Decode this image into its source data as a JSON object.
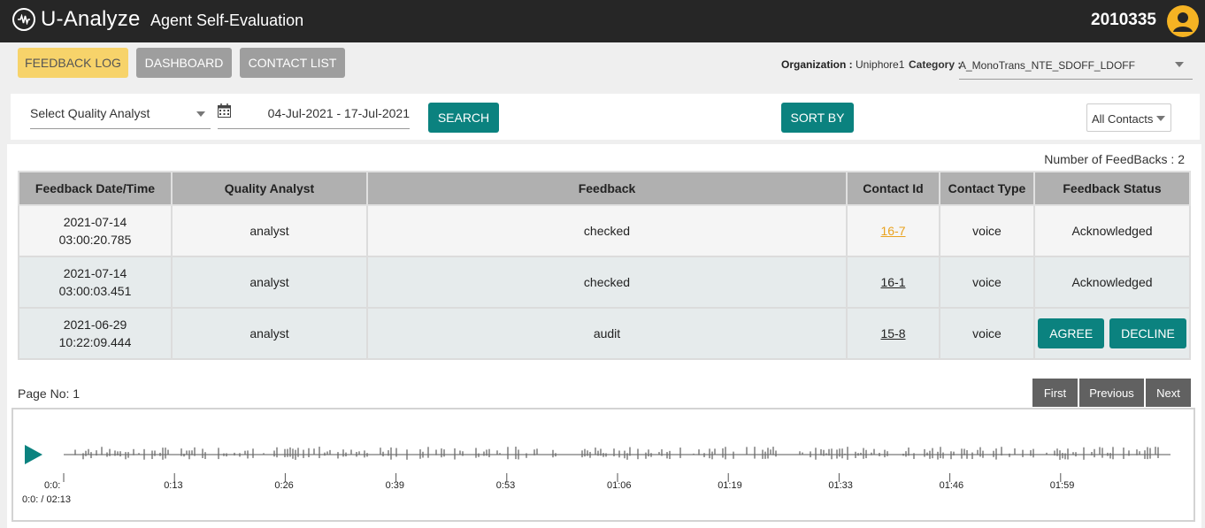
{
  "header": {
    "logo_text": "U-Analyze",
    "app_title": "Agent Self-Evaluation",
    "user_id": "2010335"
  },
  "nav": {
    "tabs": [
      {
        "label": "FEEDBACK LOG",
        "active": true
      },
      {
        "label": "DASHBOARD",
        "active": false
      },
      {
        "label": "CONTACT LIST",
        "active": false
      }
    ]
  },
  "filters": {
    "organization_label": "Organization :",
    "organization_value": "Uniphore1",
    "category_label": "Category :",
    "category_value": "A_MonoTrans_NTE_SDOFF_LDOFF",
    "quality_analyst_placeholder": "Select Quality Analyst",
    "date_range": "04-Jul-2021 - 17-Jul-2021",
    "search_label": "SEARCH",
    "sort_label": "SORT BY",
    "contacts_filter": "All Contacts"
  },
  "feedback": {
    "count_text": "Number of FeedBacks : 2",
    "columns": [
      "Feedback Date/Time",
      "Quality Analyst",
      "Feedback",
      "Contact Id",
      "Contact Type",
      "Feedback Status"
    ],
    "rows": [
      {
        "date": "2021-07-14",
        "time": "03:00:20.785",
        "analyst": "analyst",
        "feedback": "checked",
        "contact_id": "16-7",
        "contact_type": "voice",
        "status": "Acknowledged"
      },
      {
        "date": "2021-07-14",
        "time": "03:00:03.451",
        "analyst": "analyst",
        "feedback": "checked",
        "contact_id": "16-1",
        "contact_type": "voice",
        "status": "Acknowledged"
      },
      {
        "date": "2021-06-29",
        "time": "10:22:09.444",
        "analyst": "analyst",
        "feedback": "audit",
        "contact_id": "15-8",
        "contact_type": "voice",
        "agree_label": "AGREE",
        "decline_label": "DECLINE"
      }
    ]
  },
  "pagination": {
    "page_text": "Page No: 1",
    "first": "First",
    "previous": "Previous",
    "next": "Next"
  },
  "player": {
    "ticks": [
      "0:0:",
      "0:13",
      "0:26",
      "0:39",
      "0:53",
      "01:06",
      "01:19",
      "01:33",
      "01:46",
      "01:59"
    ],
    "time_display": "0:0: / 02:13"
  },
  "colors": {
    "accent": "#0b827f",
    "active_tab": "#f7d36a",
    "link_highlight": "#e9a21f",
    "topbar": "#262626"
  }
}
